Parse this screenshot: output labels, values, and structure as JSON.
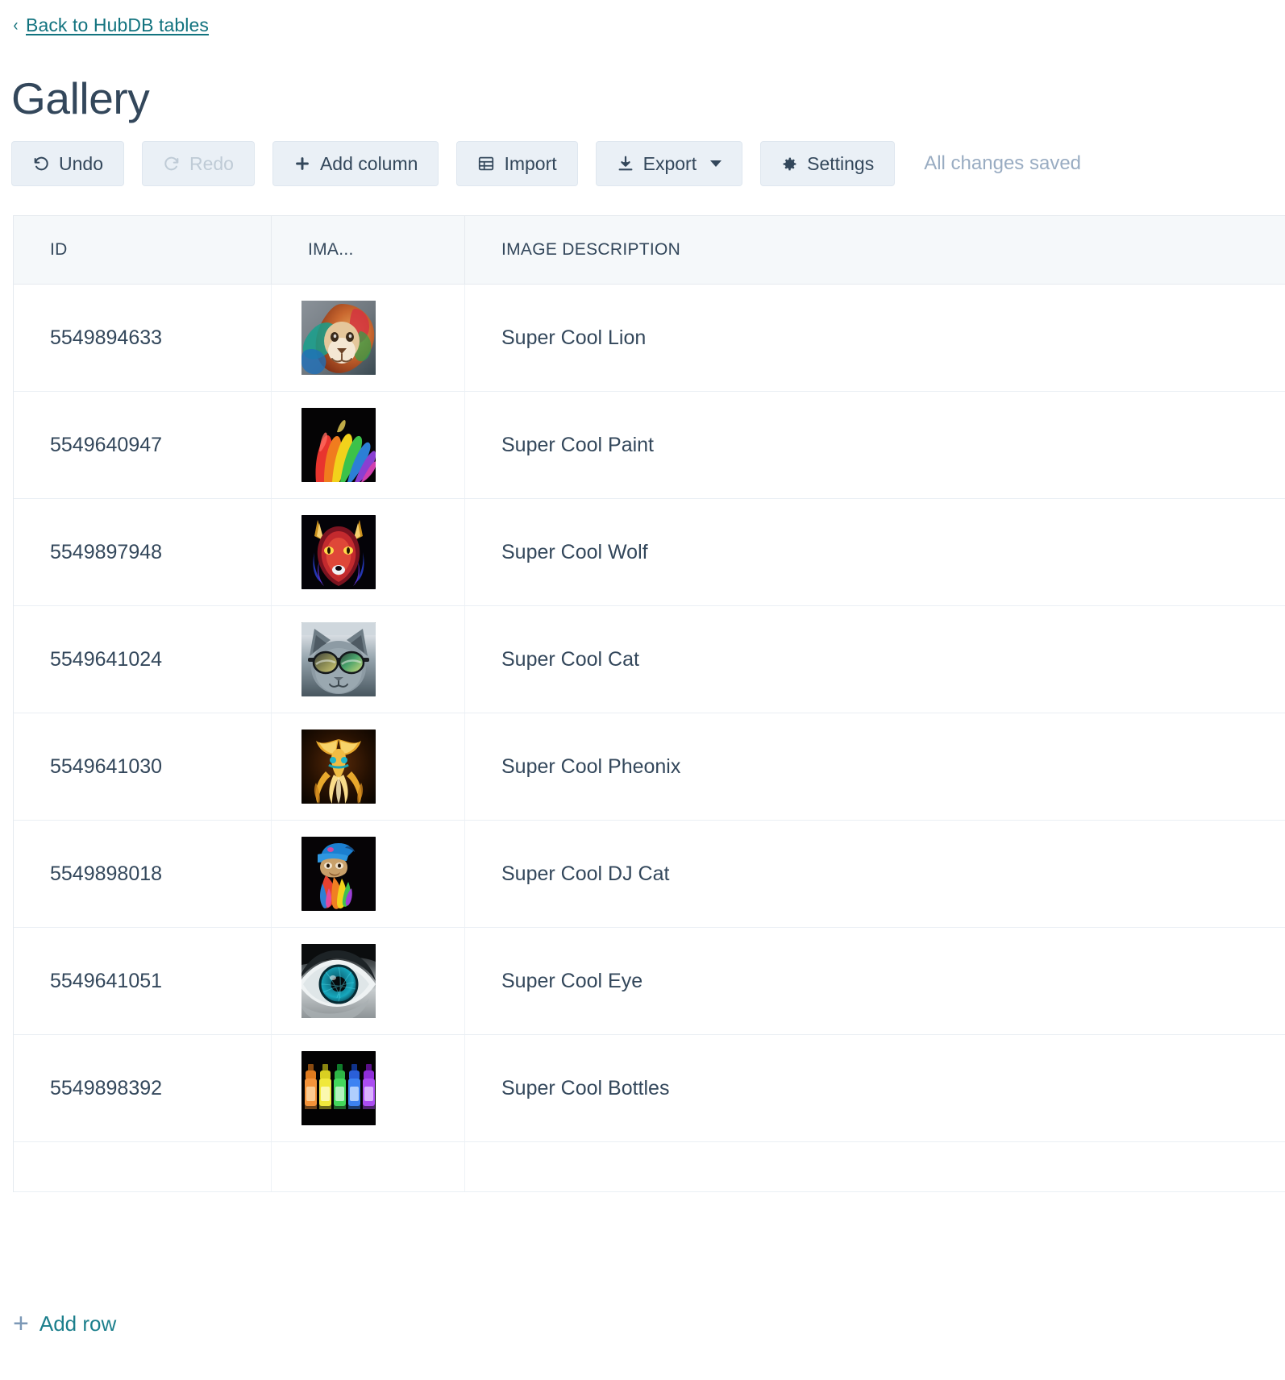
{
  "breadcrumb": {
    "back_label": "Back to HubDB tables",
    "chevron": "‹"
  },
  "page_title": "Gallery",
  "toolbar": {
    "undo_label": "Undo",
    "redo_label": "Redo",
    "add_column_label": "Add column",
    "import_label": "Import",
    "export_label": "Export",
    "settings_label": "Settings",
    "status_text": "All changes saved"
  },
  "table": {
    "columns": [
      {
        "key": "id",
        "label": "ID"
      },
      {
        "key": "image",
        "label": "IMA..."
      },
      {
        "key": "description",
        "label": "IMAGE DESCRIPTION"
      }
    ],
    "rows": [
      {
        "id": "5549894633",
        "image_alt": "lion-thumbnail",
        "description": "Super Cool Lion"
      },
      {
        "id": "5549640947",
        "image_alt": "paint-thumbnail",
        "description": "Super Cool Paint"
      },
      {
        "id": "5549897948",
        "image_alt": "wolf-thumbnail",
        "description": "Super Cool Wolf"
      },
      {
        "id": "5549641024",
        "image_alt": "cat-thumbnail",
        "description": "Super Cool Cat"
      },
      {
        "id": "5549641030",
        "image_alt": "phoenix-thumbnail",
        "description": "Super Cool Pheonix"
      },
      {
        "id": "5549898018",
        "image_alt": "dj-cat-thumbnail",
        "description": "Super Cool DJ Cat"
      },
      {
        "id": "5549641051",
        "image_alt": "eye-thumbnail",
        "description": "Super Cool Eye"
      },
      {
        "id": "5549898392",
        "image_alt": "bottles-thumbnail",
        "description": "Super Cool Bottles"
      }
    ]
  },
  "footer": {
    "add_row_label": "Add row",
    "add_row_icon": "+"
  },
  "colors": {
    "link": "#12737f",
    "title": "#33475b",
    "button_bg": "#eaf0f6",
    "button_text": "#33475b",
    "disabled_text": "#bfcbd6",
    "status_text": "#99acc2",
    "header_row_bg": "#f5f8fa",
    "border": "#e5eaef",
    "add_row": "#1c7f8c"
  }
}
